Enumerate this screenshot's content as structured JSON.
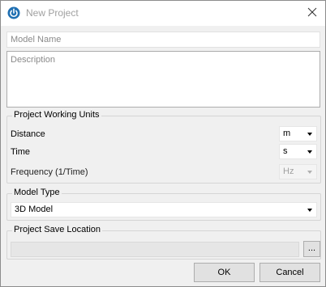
{
  "window": {
    "title": "New Project",
    "app_icon": "power-icon",
    "close_icon": "close-icon"
  },
  "fields": {
    "model_name_placeholder": "Model Name",
    "description_placeholder": "Description"
  },
  "working_units": {
    "group_label": "Project Working Units",
    "distance_label": "Distance",
    "distance_value": "m",
    "time_label": "Time",
    "time_value": "s",
    "frequency_label": "Frequency (1/Time)",
    "frequency_value": "Hz"
  },
  "model_type": {
    "group_label": "Model Type",
    "selected": "3D Model"
  },
  "save_location": {
    "group_label": "Project Save Location",
    "path": "",
    "browse_label": "..."
  },
  "buttons": {
    "ok": "OK",
    "cancel": "Cancel"
  },
  "colors": {
    "accent": "#1f6fb2",
    "title_text": "#a0a0a0"
  }
}
